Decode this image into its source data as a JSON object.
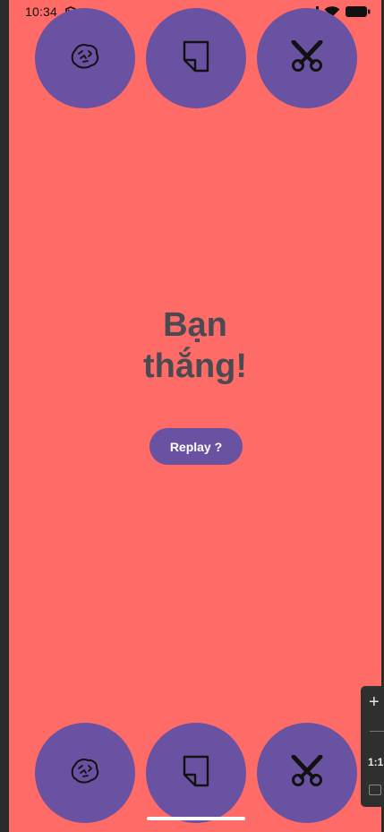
{
  "status": {
    "time": "10:34"
  },
  "choices_top": [
    {
      "icon": "rock-icon"
    },
    {
      "icon": "paper-icon"
    },
    {
      "icon": "scissors-icon"
    }
  ],
  "choices_bottom": [
    {
      "icon": "rock-icon"
    },
    {
      "icon": "paper-icon"
    },
    {
      "icon": "scissors-icon"
    }
  ],
  "result": {
    "line1": "Bạn",
    "line2": "thắng!"
  },
  "replay_label": "Replay ?",
  "toolbar": {
    "zoom_in": "+",
    "ratio": "1:1"
  },
  "colors": {
    "background": "#ff6b66",
    "accent": "#6a52a3",
    "result_text": "#4a4a52"
  }
}
